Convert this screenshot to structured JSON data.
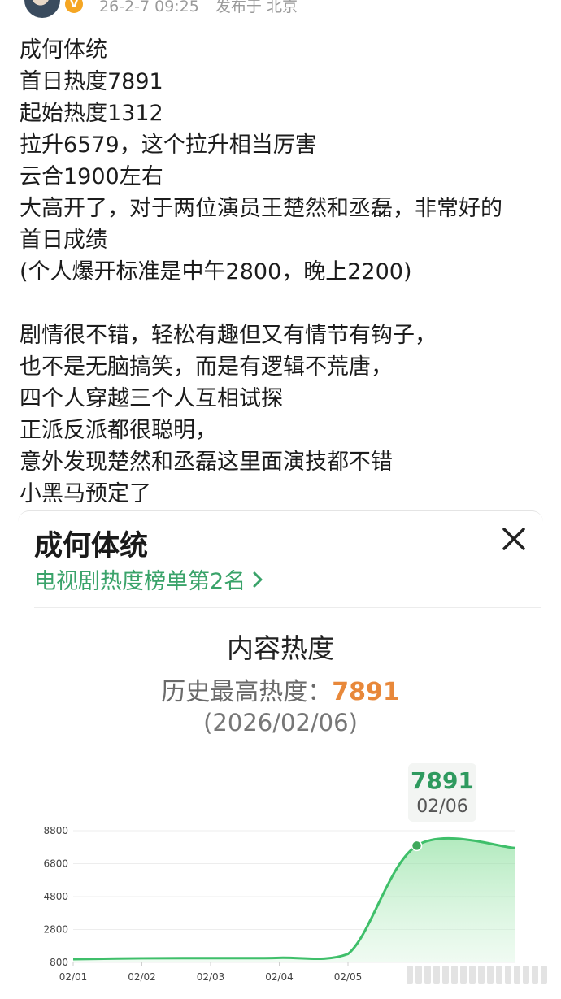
{
  "header": {
    "timestamp": "26-2-7 09:25",
    "location": "发布于 北京"
  },
  "post": {
    "lines": [
      "成何体统",
      "首日热度7891",
      "起始热度1312",
      "拉升6579，这个拉升相当厉害",
      "云合1900左右",
      "大高开了，对于两位演员王楚然和丞磊，非常好的",
      "首日成绩",
      "(个人爆开标准是中午2800，晚上2200)",
      "",
      "剧情很不错，轻松有趣但又有情节有钩子，",
      "也不是无脑搞笑，而是有逻辑不荒唐，",
      "四个人穿越三个人互相试探",
      "正派反派都很聪明，",
      "意外发现楚然和丞磊这里面演技都不错",
      "小黑马预定了"
    ]
  },
  "card": {
    "title": "成何体统",
    "rank_link": "电视剧热度榜单第2名",
    "section_title": "内容热度",
    "peak_label": "历史最高热度：",
    "peak_value": "7891",
    "peak_date": "(2026/02/06)",
    "callout_value": "7891",
    "callout_date": "02/06",
    "accent_color": "#3aa36a",
    "peak_color": "#e8883a"
  },
  "chart_data": {
    "type": "area",
    "x": [
      "02/01",
      "02/02",
      "02/03",
      "02/04",
      "02/05",
      "02/06",
      "02/07"
    ],
    "y": [
      1000,
      1050,
      1060,
      1080,
      1312,
      7891,
      7750
    ],
    "ylim": [
      800,
      8800
    ],
    "yticks": [
      800,
      2800,
      4800,
      6800,
      8800
    ],
    "xticks": [
      "02/01",
      "02/02",
      "02/03",
      "02/04",
      "02/05"
    ],
    "highlight_point": {
      "x": "02/06",
      "y": 7891
    },
    "grid": true,
    "color": "#3fbf6a"
  }
}
